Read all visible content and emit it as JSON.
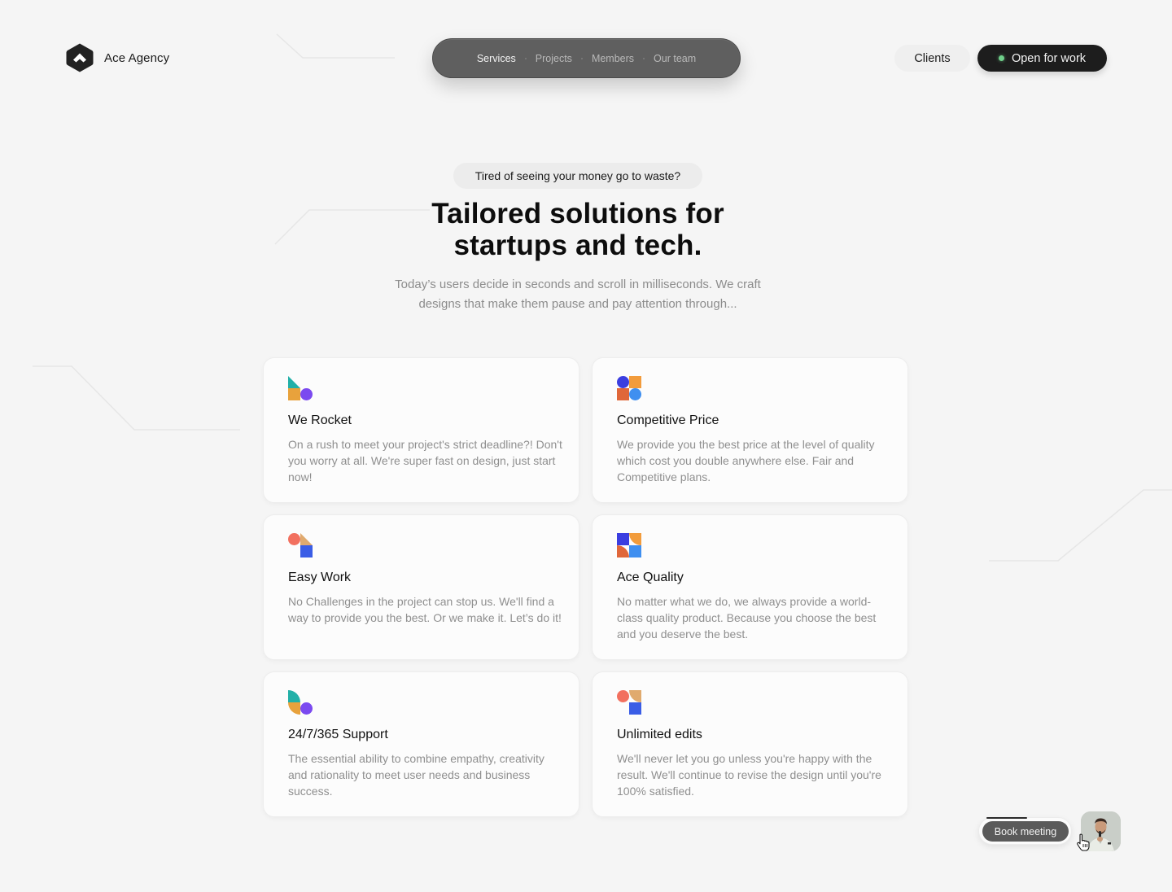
{
  "brand": {
    "name": "Ace Agency",
    "logo_icon": "hexagon-chevron-logo"
  },
  "nav": {
    "items": [
      {
        "label": "Services",
        "active": true
      },
      {
        "label": "Projects",
        "active": false
      },
      {
        "label": "Members",
        "active": false
      },
      {
        "label": "Our team",
        "active": false
      }
    ]
  },
  "header_actions": {
    "clients_label": "Clients",
    "open_label": "Open for work",
    "status_color": "#6fcf8a"
  },
  "hero": {
    "eyebrow": "Tired of seeing your money go to waste?",
    "title_line1": "Tailored solutions for",
    "title_line2": "startups and tech.",
    "subtitle_line1": "Today’s users decide in seconds and scroll in milliseconds. We craft",
    "subtitle_line2": "designs that make them pause and pay attention through..."
  },
  "features": [
    {
      "icon": "rocket-shapes-icon",
      "title": "We Rocket",
      "description": "On a rush to meet your project's strict deadline?! Don't you worry at all. We're super fast on design, just start now!"
    },
    {
      "icon": "price-shapes-icon",
      "title": "Competitive Price",
      "description": "We provide you the best price at the level of quality which cost you double anywhere else. Fair and Competitive plans."
    },
    {
      "icon": "easy-work-shapes-icon",
      "title": "Easy Work",
      "description": "No Challenges in the project can stop us. We'll find a way to provide you the best. Or we make it. Let’s do it!"
    },
    {
      "icon": "quality-shapes-icon",
      "title": "Ace Quality",
      "description": "No matter what we do, we always provide a world-class quality product. Because you choose the best and you deserve the best."
    },
    {
      "icon": "support-shapes-icon",
      "title": "24/7/365 Support",
      "description": "The essential ability to combine empathy, creativity and rationality to meet user needs and business success."
    },
    {
      "icon": "edits-shapes-icon",
      "title": "Unlimited edits",
      "description": "We'll never let you go unless you're happy with the result. We'll continue to revise the design until you're 100% satisfied."
    }
  ],
  "booking": {
    "label": "Book meeting",
    "avatar": "team-member-avatar"
  },
  "colors": {
    "teal": "#22b0a8",
    "amber": "#e8a23c",
    "purple": "#7b4af0",
    "indigo": "#3b3ee0",
    "orange": "#f29c3c",
    "burnt": "#e0673a",
    "sky": "#3f8ff0",
    "coral": "#f2705f",
    "tan": "#e0aa6e",
    "blue": "#3a5de6"
  }
}
